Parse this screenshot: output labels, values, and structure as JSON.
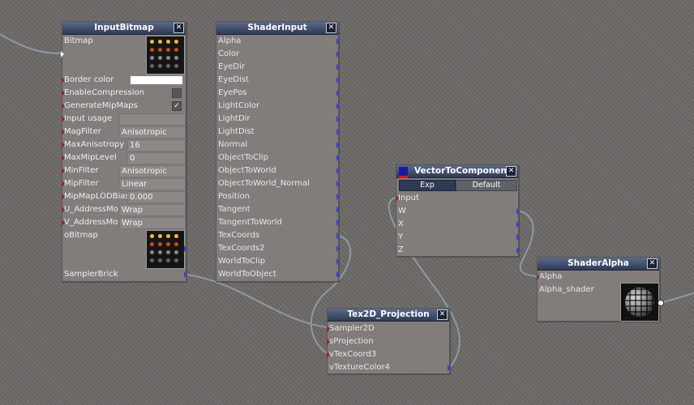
{
  "nodes": {
    "input_bitmap": {
      "title": "InputBitmap",
      "rows": [
        {
          "label": "Bitmap",
          "value": ""
        },
        {
          "label": "Border color",
          "value": ""
        },
        {
          "label": "EnableCompression",
          "value": ""
        },
        {
          "label": "GenerateMipMaps",
          "value": "✓"
        },
        {
          "label": "Input usage",
          "value": ""
        },
        {
          "label": "MagFilter",
          "value": "Anisotropic"
        },
        {
          "label": "MaxAnisotropy",
          "value": "16"
        },
        {
          "label": "MaxMipLevel",
          "value": "0"
        },
        {
          "label": "MinFilter",
          "value": "Anisotropic"
        },
        {
          "label": "MipFilter",
          "value": "Linear"
        },
        {
          "label": "MipMapLODBias",
          "value": "0.000"
        },
        {
          "label": "U_AddressMo",
          "value": "Wrap"
        },
        {
          "label": "V_AddressMo",
          "value": "Wrap"
        },
        {
          "label": "oBitmap",
          "value": ""
        },
        {
          "label": "SamplerBrick",
          "value": ""
        }
      ]
    },
    "shader_input": {
      "title": "ShaderInput",
      "rows": [
        "Alpha",
        "Color",
        "EyeDir",
        "EyeDist",
        "EyePos",
        "LightColor",
        "LightDir",
        "LightDist",
        "Normal",
        "ObjectToClip",
        "ObjectToWorld",
        "ObjectToWorld_Normal",
        "Position",
        "Tangent",
        "TangentToWorld",
        "TexCoords",
        "TexCoords2",
        "WorldToClip",
        "WorldToObject"
      ]
    },
    "vector_to_components": {
      "title": "VectorToComponents",
      "tabs": [
        "Exp",
        "Default"
      ],
      "rows": [
        "Input",
        "W",
        "X",
        "Y",
        "Z"
      ]
    },
    "shader_alpha": {
      "title": "ShaderAlpha",
      "rows": [
        "Alpha",
        "Alpha_shader"
      ]
    },
    "tex2d_projection": {
      "title": "Tex2D_Projection",
      "rows": [
        "Sampler2D",
        "sProjection",
        "vTexCoord3",
        "vTextureColor4"
      ]
    }
  },
  "close_glyph": "✕",
  "colors": {
    "background": "#6e6a68",
    "node_body": "#827c7b",
    "title_bar": "#2f3a55",
    "input_port": "#8b2a2a",
    "output_port": "#3b3fd0",
    "wire": "#8a9aa6"
  }
}
